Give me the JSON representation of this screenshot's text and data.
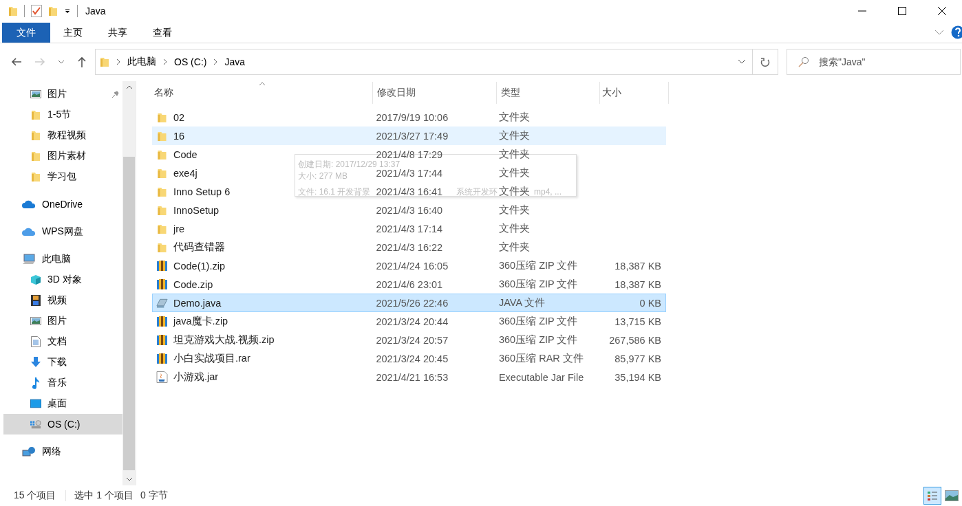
{
  "window": {
    "title": "Java"
  },
  "ribbon": {
    "tabs": [
      {
        "label": "文件",
        "kind": "file-menu"
      },
      {
        "label": "主页",
        "kind": "tab"
      },
      {
        "label": "共享",
        "kind": "tab"
      },
      {
        "label": "查看",
        "kind": "tab"
      }
    ]
  },
  "address": {
    "segments": [
      "此电脑",
      "OS (C:)",
      "Java"
    ]
  },
  "search": {
    "placeholder": "搜索\"Java\""
  },
  "nav": {
    "quick_access": [
      {
        "label": "图片",
        "kind": "pictures",
        "pinned": true
      },
      {
        "label": "1-5节",
        "kind": "folder",
        "pinned": false
      },
      {
        "label": "教程视频",
        "kind": "folder",
        "pinned": false
      },
      {
        "label": "图片素材",
        "kind": "folder",
        "pinned": false
      },
      {
        "label": "学习包",
        "kind": "folder",
        "pinned": false
      }
    ],
    "places": [
      {
        "label": "OneDrive",
        "kind": "onedrive",
        "selected": false
      },
      {
        "label": "WPS网盘",
        "kind": "cloud",
        "selected": false
      },
      {
        "label": "此电脑",
        "kind": "pc",
        "selected": false,
        "children": [
          {
            "label": "3D 对象",
            "kind": "cube",
            "selected": false
          },
          {
            "label": "视频",
            "kind": "video",
            "selected": false
          },
          {
            "label": "图片",
            "kind": "pictures",
            "selected": false
          },
          {
            "label": "文档",
            "kind": "document",
            "selected": false
          },
          {
            "label": "下载",
            "kind": "download",
            "selected": false
          },
          {
            "label": "音乐",
            "kind": "music",
            "selected": false
          },
          {
            "label": "桌面",
            "kind": "desktop",
            "selected": false
          },
          {
            "label": "OS (C:)",
            "kind": "drive",
            "selected": true
          }
        ]
      },
      {
        "label": "网络",
        "kind": "network",
        "selected": false
      }
    ]
  },
  "columns": [
    {
      "label": "名称",
      "sorted": true
    },
    {
      "label": "修改日期",
      "sorted": false
    },
    {
      "label": "类型",
      "sorted": false
    },
    {
      "label": "大小",
      "sorted": false
    }
  ],
  "files": [
    {
      "name": "02",
      "modified": "2017/9/19 10:06",
      "type": "文件夹",
      "kind": "folder",
      "selected": false,
      "hovered": false
    },
    {
      "name": "16",
      "modified": "2021/3/27 17:49",
      "type": "文件夹",
      "kind": "folder",
      "selected": false,
      "hovered": true
    },
    {
      "name": "Code",
      "modified": "2021/4/8 17:29",
      "type": "文件夹",
      "kind": "folder",
      "selected": false,
      "hovered": false
    },
    {
      "name": "exe4j",
      "modified": "2021/4/3 17:44",
      "type": "文件夹",
      "kind": "folder",
      "selected": false,
      "hovered": false
    },
    {
      "name": "Inno Setup 6",
      "modified": "2021/4/3 16:41",
      "type": "文件夹",
      "kind": "folder",
      "selected": false,
      "hovered": false
    },
    {
      "name": "InnoSetup",
      "modified": "2021/4/3 16:40",
      "type": "文件夹",
      "kind": "folder",
      "selected": false,
      "hovered": false
    },
    {
      "name": "jre",
      "modified": "2021/4/3 17:14",
      "type": "文件夹",
      "kind": "folder",
      "selected": false,
      "hovered": false
    },
    {
      "name": "代码查错器",
      "modified": "2021/4/3 16:22",
      "type": "文件夹",
      "kind": "folder",
      "selected": false,
      "hovered": false
    },
    {
      "name": "Code(1).zip",
      "modified": "2021/4/24 16:05",
      "type": "360压缩 ZIP 文件",
      "size": "18,387 KB",
      "kind": "archive",
      "selected": false,
      "hovered": false
    },
    {
      "name": "Code.zip",
      "modified": "2021/4/6 23:01",
      "type": "360压缩 ZIP 文件",
      "size": "18,387 KB",
      "kind": "archive",
      "selected": false,
      "hovered": false
    },
    {
      "name": "Demo.java",
      "modified": "2021/5/26 22:46",
      "type": "JAVA 文件",
      "size": "0 KB",
      "kind": "java",
      "selected": true,
      "hovered": false
    },
    {
      "name": "java魔卡.zip",
      "modified": "2021/3/24 20:44",
      "type": "360压缩 ZIP 文件",
      "size": "13,715 KB",
      "kind": "archive",
      "selected": false,
      "hovered": false
    },
    {
      "name": "坦克游戏大战.视频.zip",
      "modified": "2021/3/24 20:57",
      "type": "360压缩 ZIP 文件",
      "size": "267,586 KB",
      "kind": "archive",
      "selected": false,
      "hovered": false
    },
    {
      "name": "小白实战项目.rar",
      "modified": "2021/3/24 20:45",
      "type": "360压缩 RAR 文件",
      "size": "85,977 KB",
      "kind": "archive",
      "selected": false,
      "hovered": false
    },
    {
      "name": "小游戏.jar",
      "modified": "2021/4/21 16:53",
      "type": "Executable Jar File",
      "size": "35,194 KB",
      "kind": "jar",
      "selected": false,
      "hovered": false
    }
  ],
  "tooltip": {
    "lines": [
      [
        "创建日期: 2017/12/29 13:37"
      ],
      [
        "大小: 277 MB"
      ],
      [
        "文件: 16.1 开发背景",
        "系统开发环",
        "mp4, ..."
      ]
    ]
  },
  "status_bar": {
    "item_count": "15 个项目",
    "selection": "选中 1 个项目",
    "size": "0 字节"
  },
  "views": [
    {
      "kind": "details",
      "selected": true
    },
    {
      "kind": "thumbnails",
      "selected": false
    }
  ]
}
